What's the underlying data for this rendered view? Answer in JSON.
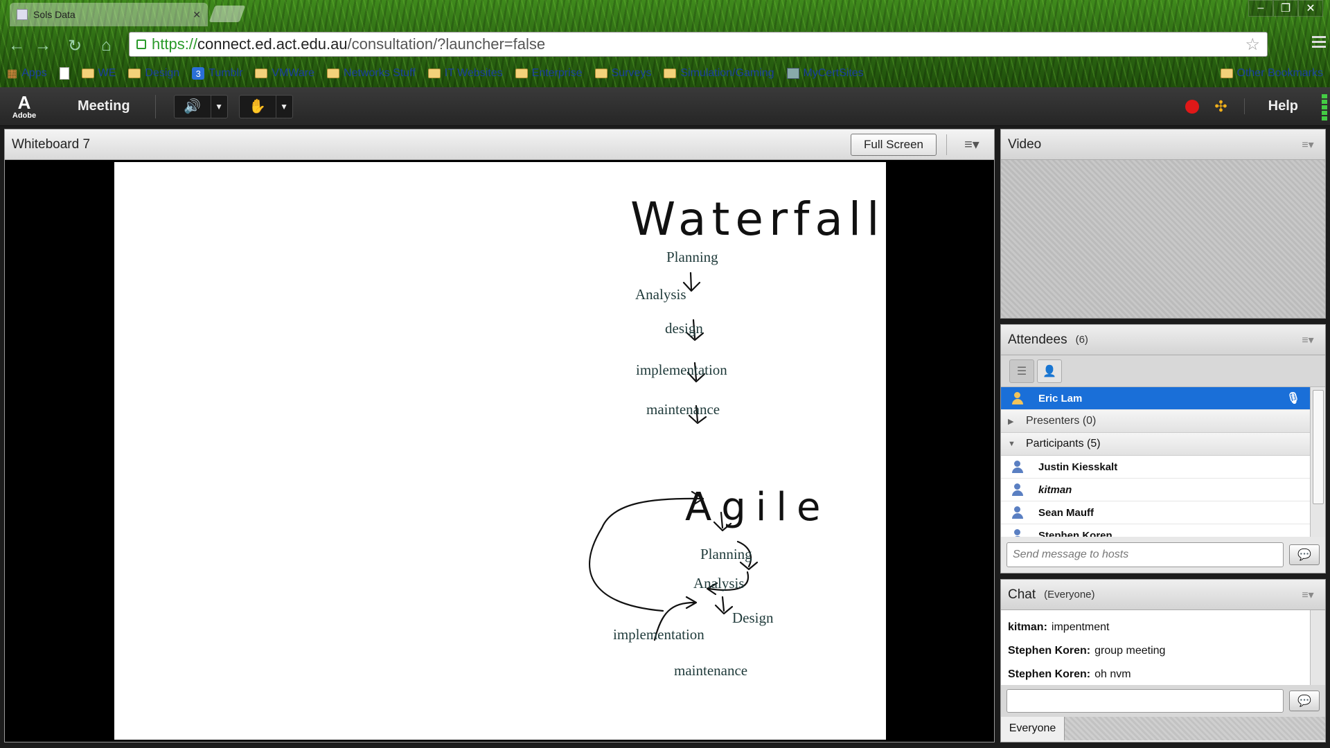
{
  "browser": {
    "tab_title": "Sols Data",
    "url_https": "https://",
    "url_host": "connect.ed.act.edu.au",
    "url_path": "/consultation/?launcher=false",
    "bookmarks": [
      {
        "label": "Apps",
        "icon": "apps-grid-icon"
      },
      {
        "label": "",
        "icon": "page-icon"
      },
      {
        "label": "WE",
        "icon": "folder-icon"
      },
      {
        "label": "Design",
        "icon": "folder-icon"
      },
      {
        "label": "Tumblr",
        "icon": "tumblr-icon"
      },
      {
        "label": "VMWare",
        "icon": "folder-icon"
      },
      {
        "label": "Networks Stuff",
        "icon": "folder-icon"
      },
      {
        "label": "IT Websites",
        "icon": "folder-icon"
      },
      {
        "label": "Enterprise",
        "icon": "folder-icon"
      },
      {
        "label": "Surveys",
        "icon": "folder-icon"
      },
      {
        "label": "Simulation/Gaming",
        "icon": "folder-icon"
      },
      {
        "label": "MyCertSites",
        "icon": "cert-icon"
      }
    ],
    "other_bookmarks": "Other Bookmarks"
  },
  "app": {
    "logo_text": "Adobe",
    "meeting_menu": "Meeting",
    "help": "Help"
  },
  "whiteboard": {
    "title": "Whiteboard 7",
    "full_screen": "Full Screen",
    "waterfall": {
      "heading": "Waterfall",
      "steps": [
        "Planning",
        "Analysis",
        "design",
        "implementation",
        "maintenance"
      ]
    },
    "agile": {
      "heading": "Agile",
      "steps": [
        "Planning",
        "Analysis",
        "Design",
        "implementation",
        "maintenance"
      ]
    }
  },
  "video": {
    "title": "Video"
  },
  "attendees": {
    "title": "Attendees",
    "count": "(6)",
    "host": "Eric Lam",
    "presenters_group": "Presenters (0)",
    "participants_group": "Participants (5)",
    "participants": [
      "Justin Kiesskalt",
      "kitman",
      "Sean Mauff",
      "Stephen Koren"
    ],
    "send_placeholder": "Send message to hosts"
  },
  "chat": {
    "title": "Chat",
    "scope": "(Everyone)",
    "messages": [
      {
        "sender": "kitman:",
        "text": "impentment"
      },
      {
        "sender": "Stephen Koren:",
        "text": "group meeting"
      },
      {
        "sender": "Stephen Koren:",
        "text": "oh nvm"
      }
    ],
    "tab": "Everyone"
  }
}
